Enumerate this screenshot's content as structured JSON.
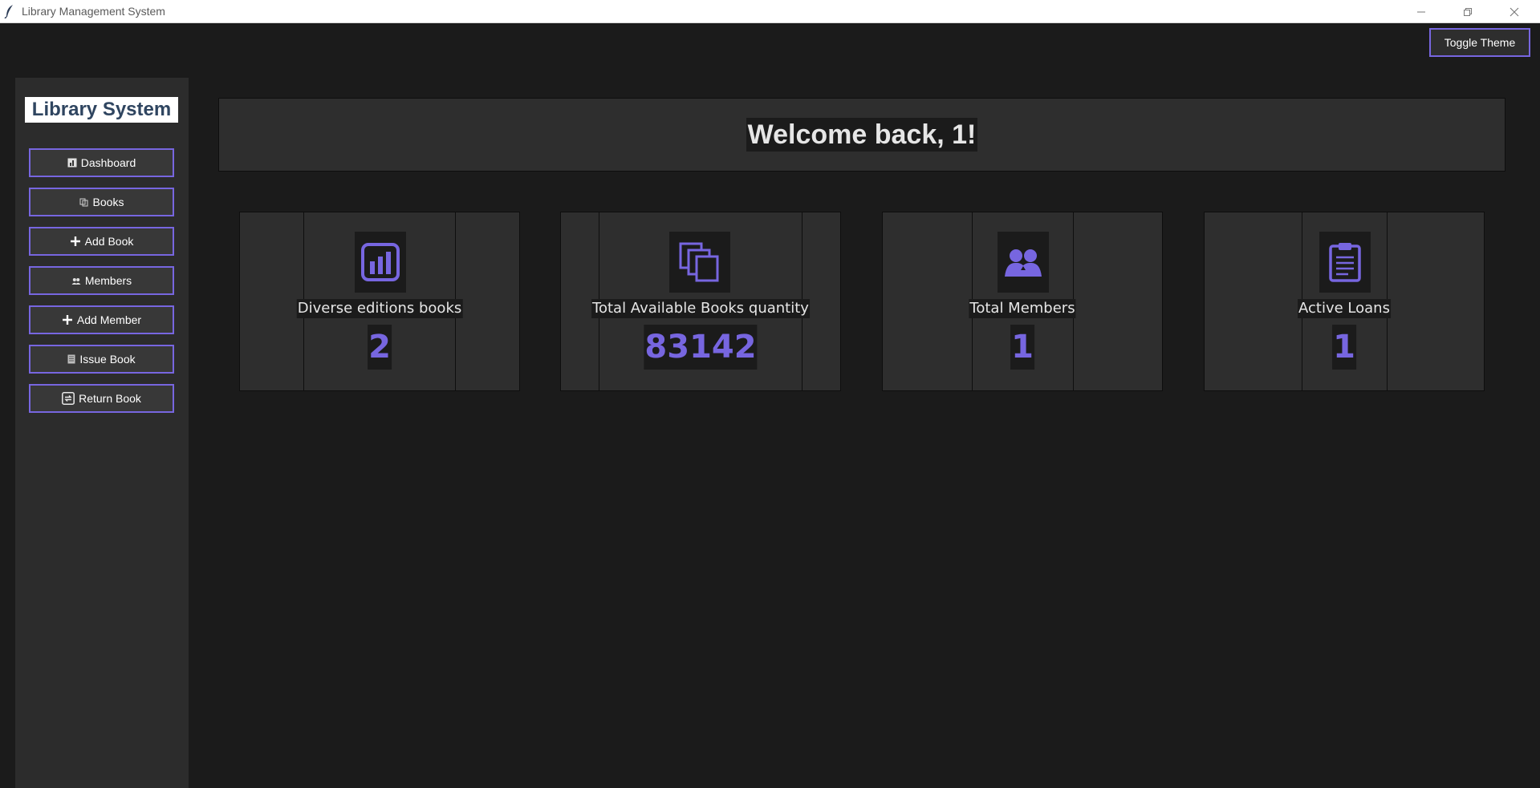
{
  "window": {
    "title": "Library Management System",
    "minimize_icon": "minimize-icon",
    "maximize_icon": "restore-icon",
    "close_icon": "close-icon"
  },
  "toolbar": {
    "toggle_theme_label": "Toggle Theme"
  },
  "sidebar": {
    "brand": "Library System",
    "items": [
      {
        "label": "Dashboard",
        "icon": "dashboard-icon"
      },
      {
        "label": "Books",
        "icon": "books-icon"
      },
      {
        "label": "Add Book",
        "icon": "plus-icon"
      },
      {
        "label": "Members",
        "icon": "members-icon"
      },
      {
        "label": "Add Member",
        "icon": "plus-icon"
      },
      {
        "label": "Issue Book",
        "icon": "issue-icon"
      },
      {
        "label": "Return Book",
        "icon": "return-icon"
      }
    ]
  },
  "header": {
    "welcome": "Welcome back, 1!"
  },
  "stats": [
    {
      "label": "Diverse editions books",
      "value": "2",
      "icon": "bar-chart-icon"
    },
    {
      "label": "Total Available Books quantity",
      "value": "83142",
      "icon": "stacked-books-icon"
    },
    {
      "label": "Total Members",
      "value": "1",
      "icon": "members-icon"
    },
    {
      "label": "Active Loans",
      "value": "1",
      "icon": "clipboard-icon"
    }
  ],
  "colors": {
    "accent": "#7766e0",
    "background": "#1b1b1b",
    "panel": "#2e2e2e",
    "text": "#e6e6e6"
  }
}
